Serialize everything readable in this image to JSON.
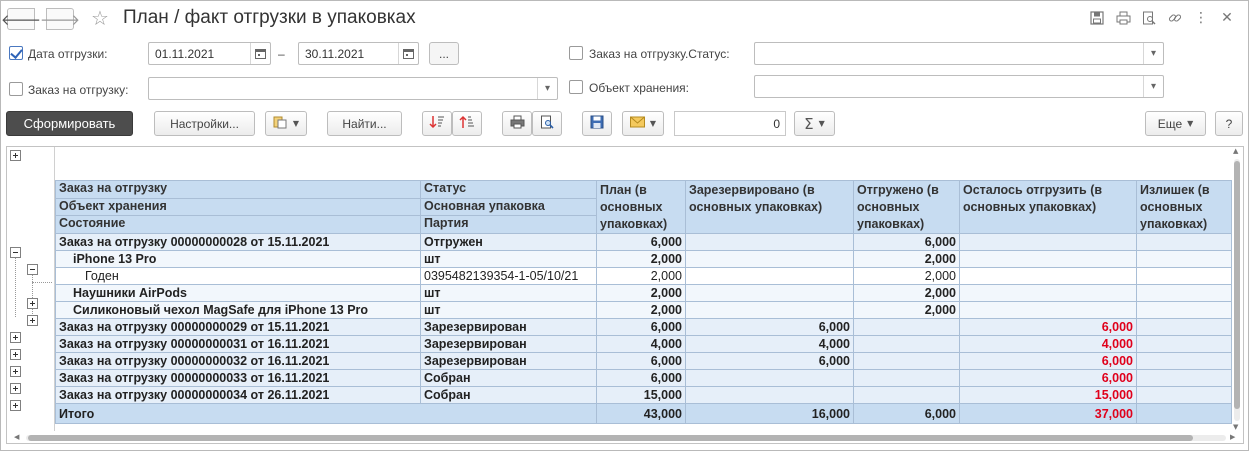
{
  "window": {
    "title": "План / факт отгрузки в упаковках",
    "icons": [
      "save-icon",
      "print-icon",
      "preview-icon",
      "link-icon",
      "more-icon",
      "close-icon"
    ]
  },
  "filters": {
    "ship_date": {
      "label": "Дата отгрузки:",
      "checked": true,
      "from": "01.11.2021",
      "to": "30.11.2021",
      "separator": "–",
      "more": "..."
    },
    "order": {
      "label": "Заказ на отгрузку:",
      "checked": false,
      "value": ""
    },
    "order_status": {
      "label": "Заказ на отгрузку.Статус:",
      "checked": false,
      "value": ""
    },
    "storage": {
      "label": "Объект хранения:",
      "checked": false,
      "value": ""
    }
  },
  "toolbar": {
    "generate": "Сформировать",
    "settings": "Настройки...",
    "find": "Найти...",
    "sum_value": "0",
    "more": "Еще",
    "help": "?"
  },
  "table": {
    "headers": {
      "col1": [
        "Заказ на отгрузку",
        "Объект хранения",
        "Состояние"
      ],
      "col2": [
        "Статус",
        "Основная упаковка",
        "Партия"
      ],
      "plan": "План (в основных упаковках)",
      "reserved": "Зарезервировано (в основных упаковках)",
      "shipped": "Отгружено (в основных упаковках)",
      "remaining": "Осталось отгрузить (в основных упаковках)",
      "surplus": "Излишек (в основных упаковках)"
    },
    "rows": [
      {
        "level": 0,
        "name": "Заказ на отгрузку 00000000028 от 15.11.2021",
        "status": "Отгружен",
        "plan": "6,000",
        "reserved": "",
        "shipped": "6,000",
        "remaining": "",
        "surplus": ""
      },
      {
        "level": 1,
        "name": "iPhone 13 Pro",
        "status": "шт",
        "plan": "2,000",
        "reserved": "",
        "shipped": "2,000",
        "remaining": "",
        "surplus": ""
      },
      {
        "level": 2,
        "name": "Годен",
        "status": "0395482139354-1-05/10/21",
        "plan": "2,000",
        "reserved": "",
        "shipped": "2,000",
        "remaining": "",
        "surplus": ""
      },
      {
        "level": 1,
        "name": "Наушники AirPods",
        "status": "шт",
        "plan": "2,000",
        "reserved": "",
        "shipped": "2,000",
        "remaining": "",
        "surplus": ""
      },
      {
        "level": 1,
        "name": "Силиконовый чехол MagSafe для iPhone 13 Pro",
        "status": "шт",
        "plan": "2,000",
        "reserved": "",
        "shipped": "2,000",
        "remaining": "",
        "surplus": ""
      },
      {
        "level": 0,
        "name": "Заказ на отгрузку 00000000029 от 15.11.2021",
        "status": "Зарезервирован",
        "plan": "6,000",
        "reserved": "6,000",
        "shipped": "",
        "remaining": "6,000",
        "surplus": ""
      },
      {
        "level": 0,
        "name": "Заказ на отгрузку 00000000031 от 16.11.2021",
        "status": "Зарезервирован",
        "plan": "4,000",
        "reserved": "4,000",
        "shipped": "",
        "remaining": "4,000",
        "surplus": ""
      },
      {
        "level": 0,
        "name": "Заказ на отгрузку 00000000032 от 16.11.2021",
        "status": "Зарезервирован",
        "plan": "6,000",
        "reserved": "6,000",
        "shipped": "",
        "remaining": "6,000",
        "surplus": ""
      },
      {
        "level": 0,
        "name": "Заказ на отгрузку 00000000033 от 16.11.2021",
        "status": "Собран",
        "plan": "6,000",
        "reserved": "",
        "shipped": "",
        "remaining": "6,000",
        "surplus": ""
      },
      {
        "level": 0,
        "name": "Заказ на отгрузку 00000000034 от 26.11.2021",
        "status": "Собран",
        "plan": "15,000",
        "reserved": "",
        "shipped": "",
        "remaining": "15,000",
        "surplus": ""
      }
    ],
    "total": {
      "label": "Итого",
      "plan": "43,000",
      "reserved": "16,000",
      "shipped": "6,000",
      "remaining": "37,000",
      "surplus": ""
    }
  },
  "colors": {
    "header_bg": "#c7dcf1",
    "row_bg": "#e6eff9",
    "remaining_text": "#e0001b",
    "primary_btn": "#4d4d4d"
  }
}
